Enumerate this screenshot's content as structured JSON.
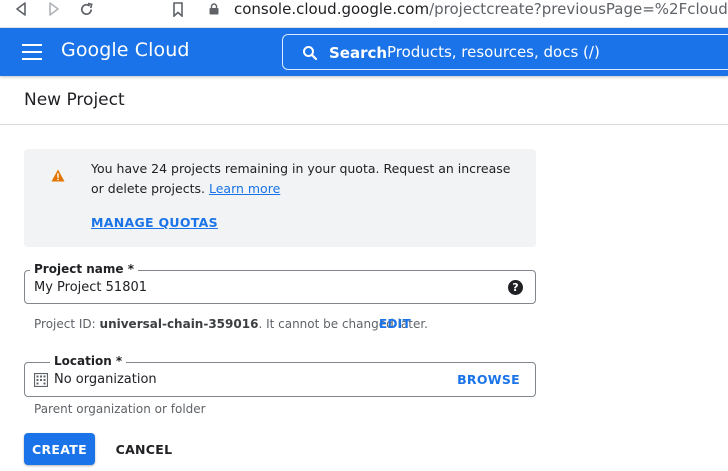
{
  "browser": {
    "url_host": "console.cloud.google.com",
    "url_path": "/projectcreate?previousPage=%2Fcloud-resource-ma",
    "icons": [
      "back-icon",
      "forward-icon",
      "reload-icon",
      "bookmark-icon",
      "lock-icon"
    ]
  },
  "header": {
    "brand": "Google Cloud",
    "search_label": "Search",
    "search_placeholder": "Products, resources, docs (/)",
    "accent_color": "#1a73e8"
  },
  "page": {
    "title": "New Project"
  },
  "notice": {
    "text": "You have 24 projects remaining in your quota. Request an increase or delete projects.",
    "link": "Learn more",
    "action": "MANAGE QUOTAS",
    "icon": "warning-icon",
    "warning_color": "#e37400"
  },
  "form": {
    "project_name": {
      "label": "Project name *",
      "value": "My Project 51801"
    },
    "project_id": {
      "prefix": "Project ID:",
      "value": "universal-chain-359016",
      "suffix": ". It cannot be changed later.",
      "edit": "EDIT"
    },
    "location": {
      "label": "Location *",
      "value": "No organization",
      "browse": "BROWSE",
      "hint": "Parent organization or folder"
    },
    "create": "CREATE",
    "cancel": "CANCEL"
  }
}
